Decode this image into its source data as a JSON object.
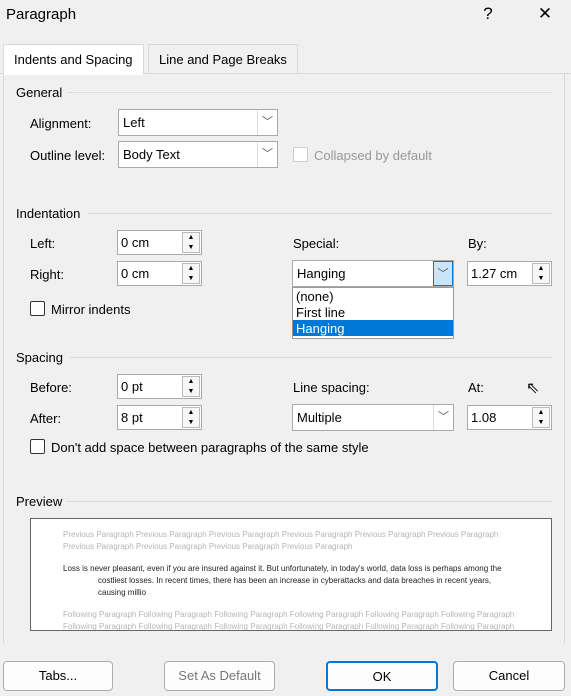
{
  "dialog": {
    "title": "Paragraph",
    "help_label": "?",
    "close_label": "✕"
  },
  "tabs": [
    {
      "label": "Indents and Spacing"
    },
    {
      "label": "Line and Page Breaks"
    }
  ],
  "general": {
    "heading": "General",
    "alignment_label": "Alignment:",
    "alignment_value": "Left",
    "outline_label": "Outline level:",
    "outline_value": "Body Text",
    "collapsed_label": "Collapsed by default"
  },
  "indentation": {
    "heading": "Indentation",
    "left_label": "Left:",
    "left_value": "0 cm",
    "right_label": "Right:",
    "right_value": "0 cm",
    "special_label": "Special:",
    "special_value": "Hanging",
    "by_label": "By:",
    "by_value": "1.27 cm",
    "mirror_label": "Mirror indents",
    "special_options": [
      "(none)",
      "First line",
      "Hanging"
    ]
  },
  "spacing": {
    "heading": "Spacing",
    "before_label": "Before:",
    "before_value": "0 pt",
    "after_label": "After:",
    "after_value": "8 pt",
    "line_label": "Line spacing:",
    "line_value": "Multiple",
    "at_label": "At:",
    "at_value": "1.08",
    "dont_add_label": "Don't add space between paragraphs of the same style"
  },
  "preview": {
    "heading": "Preview",
    "previous": "Previous Paragraph Previous Paragraph Previous Paragraph Previous Paragraph Previous Paragraph Previous Paragraph Previous Paragraph Previous Paragraph Previous Paragraph Previous Paragraph",
    "text": "Loss is never pleasant, even if you are insured against it. But unfortunately, in today's world, data loss is perhaps among the costliest losses. In recent times, there has been an increase in cyberattacks and data breaches in recent years, causing millio",
    "following": "Following Paragraph Following Paragraph Following Paragraph Following Paragraph Following Paragraph Following Paragraph Following Paragraph Following Paragraph Following Paragraph Following Paragraph Following Paragraph Following Paragraph Following Paragraph Following Paragraph Following Paragraph Following Paragraph Following Paragraph"
  },
  "buttons": {
    "tabs": "Tabs...",
    "set_default": "Set As Default",
    "ok": "OK",
    "cancel": "Cancel"
  },
  "colors": {
    "accent": "#0078d7"
  }
}
